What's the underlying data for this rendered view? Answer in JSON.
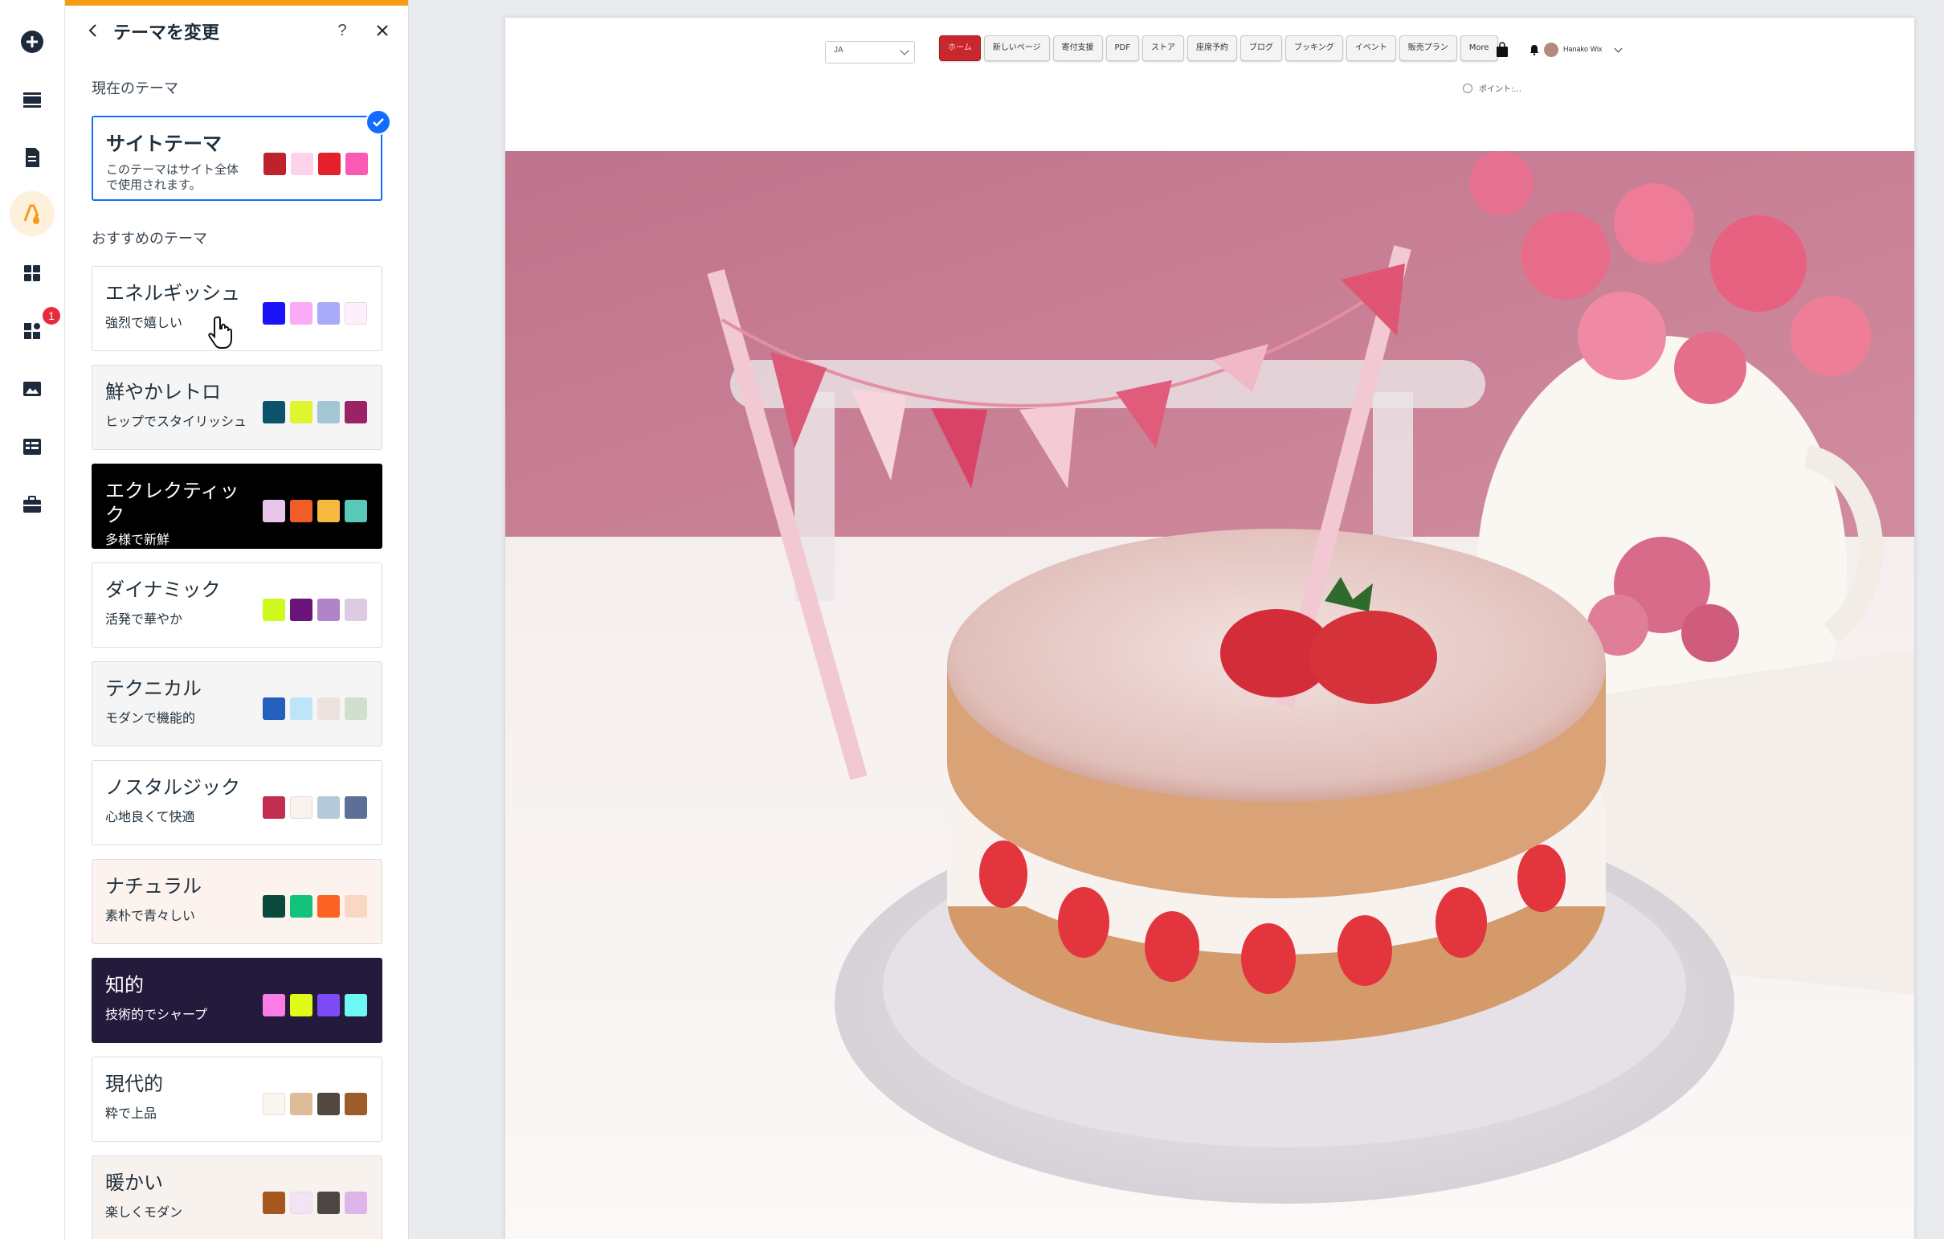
{
  "rail": {
    "items": [
      {
        "name": "add-icon"
      },
      {
        "name": "sections-icon"
      },
      {
        "name": "pages-icon"
      },
      {
        "name": "theme-icon",
        "active": true
      },
      {
        "name": "apps-icon"
      },
      {
        "name": "plugins-icon",
        "badge": "1"
      },
      {
        "name": "media-icon"
      },
      {
        "name": "cms-icon"
      },
      {
        "name": "business-icon"
      }
    ]
  },
  "panel": {
    "title": "テーマを変更",
    "help": "?",
    "current_label": "現在のテーマ",
    "current": {
      "name": "サイトテーマ",
      "desc_line1": "このテーマはサイト全体",
      "desc_line2": "で使用されます。",
      "colors": [
        "#be232c",
        "#fcd3e8",
        "#e5202b",
        "#f95ab3"
      ]
    },
    "recommended_label": "おすすめのテーマ",
    "themes": [
      {
        "name": "エネルギッシュ",
        "desc": "強烈で嬉しい",
        "bg": "#ffffff",
        "fg": "#20303c",
        "colors": [
          "#1b12f5",
          "#fbaaf5",
          "#aaabf8",
          "#fdeffc"
        ]
      },
      {
        "name": "鮮やかレトロ",
        "desc": "ヒップでスタイリッシュ",
        "bg": "#f5f5f5",
        "fg": "#20303c",
        "colors": [
          "#0a536b",
          "#dff530",
          "#a3c7d2",
          "#9a2366"
        ]
      },
      {
        "name": "エクレクティック",
        "desc": "多様で新鮮",
        "bg": "#000000",
        "fg": "#ffffff",
        "colors": [
          "#e7c6ea",
          "#f25c26",
          "#f5b940",
          "#58c9b8"
        ]
      },
      {
        "name": "ダイナミック",
        "desc": "活発で華やか",
        "bg": "#ffffff",
        "fg": "#20303c",
        "colors": [
          "#cdf91f",
          "#6a1479",
          "#b184c7",
          "#dccbe3"
        ]
      },
      {
        "name": "テクニカル",
        "desc": "モダンで機能的",
        "bg": "#f5f5f5",
        "fg": "#20303c",
        "colors": [
          "#2360bd",
          "#bfe3f8",
          "#ece2df",
          "#cfe0cf"
        ]
      },
      {
        "name": "ノスタルジック",
        "desc": "心地良くて快適",
        "bg": "#ffffff",
        "fg": "#20303c",
        "colors": [
          "#c22d50",
          "#fbf1ed",
          "#b6c9d9",
          "#5c6f96"
        ]
      },
      {
        "name": "ナチュラル",
        "desc": "素朴で青々しい",
        "bg": "#fdf3ee",
        "fg": "#20303c",
        "colors": [
          "#0a4a3d",
          "#13c27b",
          "#fb6323",
          "#f9d7c3"
        ]
      },
      {
        "name": "知的",
        "desc": "技術的でシャープ",
        "bg": "#231a3c",
        "fg": "#ffffff",
        "colors": [
          "#fb7ce4",
          "#e0fb18",
          "#7e4cf7",
          "#6ef8f5"
        ]
      },
      {
        "name": "現代的",
        "desc": "粋で上品",
        "bg": "#ffffff",
        "fg": "#20303c",
        "colors": [
          "#fbf6ef",
          "#e0bb98",
          "#54473f",
          "#9c5d2a"
        ]
      },
      {
        "name": "暖かい",
        "desc": "楽しくモダン",
        "bg": "#f8f2ef",
        "fg": "#20303c",
        "colors": [
          "#a7561f",
          "#f3e3f5",
          "#4f4444",
          "#dfb4e9"
        ]
      }
    ]
  },
  "site": {
    "lang": "JA",
    "nav": [
      "ホーム",
      "新しいページ",
      "寄付支援",
      "PDF",
      "ストア",
      "座席予約",
      "ブログ",
      "ブッキング",
      "イベント",
      "販売プラン",
      "More"
    ],
    "user_name": "Hanako Wix",
    "points": "ポイント:...",
    "accent": "#c9272e"
  }
}
